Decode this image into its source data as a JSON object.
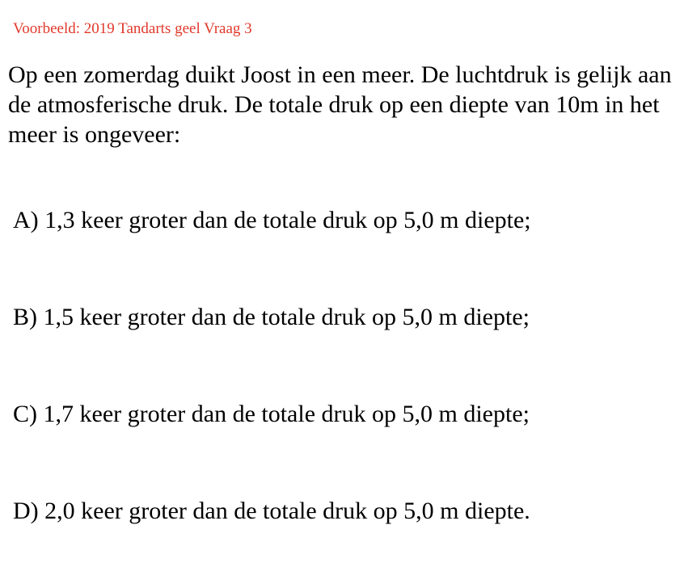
{
  "header": {
    "label": "Voorbeeld: 2019 Tandarts geel Vraag 3",
    "label_color": "#e0392b"
  },
  "question": {
    "text": "Op een zomerdag duikt Joost in een meer. De luchtdruk is gelijk aan de atmosferische druk. De totale druk op een diepte van 10m in het meer is ongeveer:"
  },
  "options": [
    {
      "text": "A) 1,3 keer groter dan de totale druk op 5,0 m diepte;"
    },
    {
      "text": "B) 1,5 keer groter dan de totale druk op 5,0 m diepte;"
    },
    {
      "text": "C) 1,7 keer groter dan de totale druk op 5,0 m diepte;"
    },
    {
      "text": "D) 2,0 keer groter dan de totale druk op 5,0 m diepte."
    }
  ]
}
